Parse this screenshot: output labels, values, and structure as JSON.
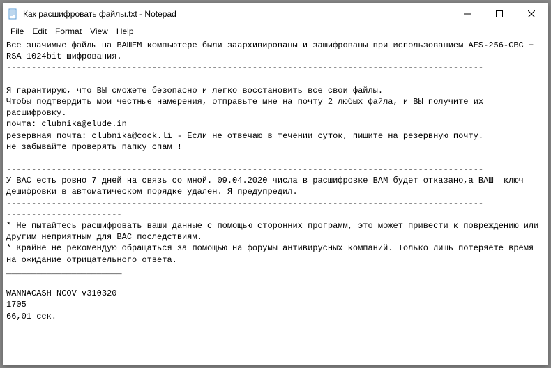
{
  "window": {
    "title": "Как расшифровать файлы.txt - Notepad"
  },
  "menu": {
    "file": "File",
    "edit": "Edit",
    "format": "Format",
    "view": "View",
    "help": "Help"
  },
  "content": {
    "body": "Все значимые файлы на ВАШЕМ компьютере были заархивированы и зашифрованы при использованием AES-256-CBC + RSA 1024bit шифрования.\n-----------------------------------------------------------------------------------------------\n\nЯ гарантирую, что ВЫ сможете безопасно и легко восстановить все свои файлы.\nЧтобы подтвердить мои честные намерения, отправьте мне на почту 2 любых файла, и ВЫ получите их расшифровку.\nпочта: clubnika@elude.in\nрезервная почта: clubnika@cock.li - Если не отвечаю в течении суток, пишите на резервную почту.\nне забывайте проверять папку спам !\n\n-----------------------------------------------------------------------------------------------\nУ ВАС есть ровно 7 дней на связь со мной. 09.04.2020 числа в расшифровке ВАМ будет отказано,а ВАШ  ключ дешифровки в автоматическом порядке удален. Я предупредил.\n-----------------------------------------------------------------------------------------------\n-----------------------\n* Не пытайтесь расшифровать ваши данные с помощью сторонних программ, это может привести к повреждению или другим неприятным для ВАС последствиям.\n* Крайне не рекомендую обращаться за помощью на форумы антивирусных компаний. Только лишь потеряете время на ожидание отрицательного ответа.\n_______________________\n\nWANNACASH NCOV v310320\n1705\n66,01 сек."
  }
}
